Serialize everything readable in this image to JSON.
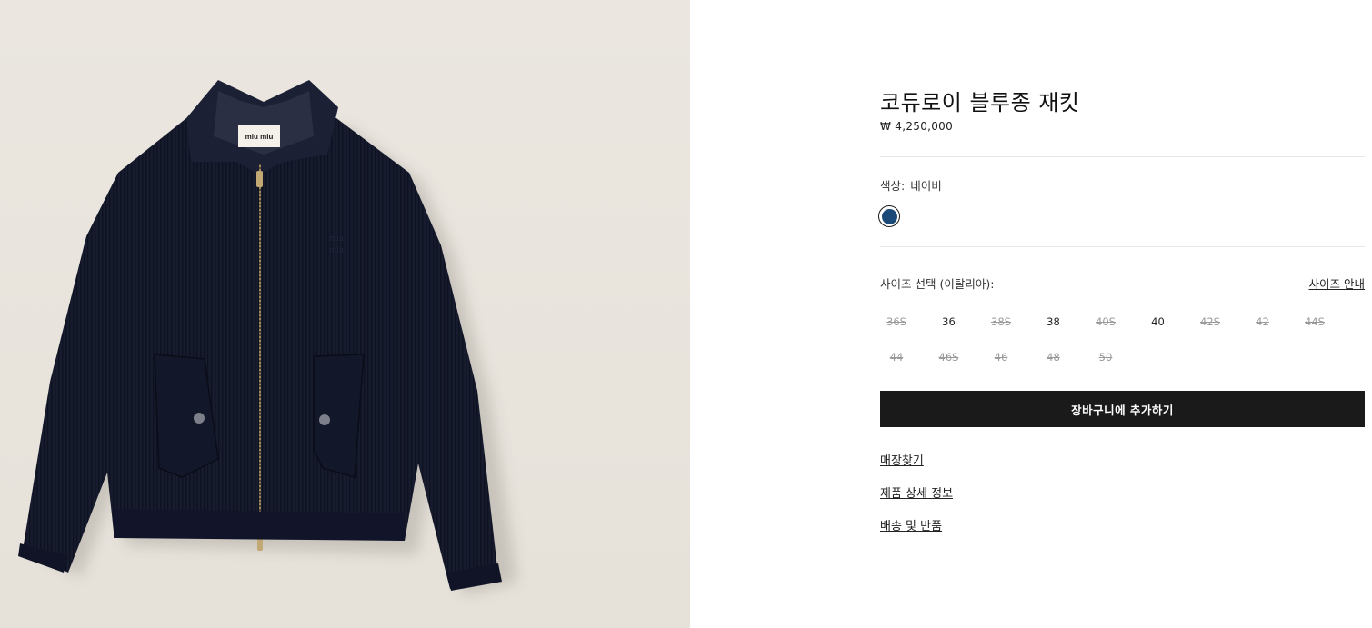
{
  "product": {
    "title": "코듀로이 블루종 재킷",
    "price": "₩ 4,250,000",
    "image_label": "miu miu"
  },
  "color": {
    "label": "색상:",
    "value": "네이비",
    "swatch_hex": "#1b4a78"
  },
  "size": {
    "label": "사이즈 선택 (이탈리아):",
    "guide_label": "사이즈 안내",
    "options": [
      {
        "label": "36S",
        "available": false
      },
      {
        "label": "36",
        "available": true
      },
      {
        "label": "38S",
        "available": false
      },
      {
        "label": "38",
        "available": true
      },
      {
        "label": "40S",
        "available": false
      },
      {
        "label": "40",
        "available": true
      },
      {
        "label": "42S",
        "available": false
      },
      {
        "label": "42",
        "available": false
      },
      {
        "label": "44S",
        "available": false
      },
      {
        "label": "44",
        "available": false
      },
      {
        "label": "46S",
        "available": false
      },
      {
        "label": "46",
        "available": false
      },
      {
        "label": "48",
        "available": false
      },
      {
        "label": "50",
        "available": false
      }
    ]
  },
  "actions": {
    "add_to_cart": "장바구니에 추가하기"
  },
  "links": {
    "store_finder": "매장찾기",
    "product_details": "제품 상세 정보",
    "shipping_returns": "배송 및 반품"
  },
  "colors": {
    "background_image": "#e8e4dd",
    "jacket": "#161a2c",
    "button": "#1a1a1a"
  }
}
